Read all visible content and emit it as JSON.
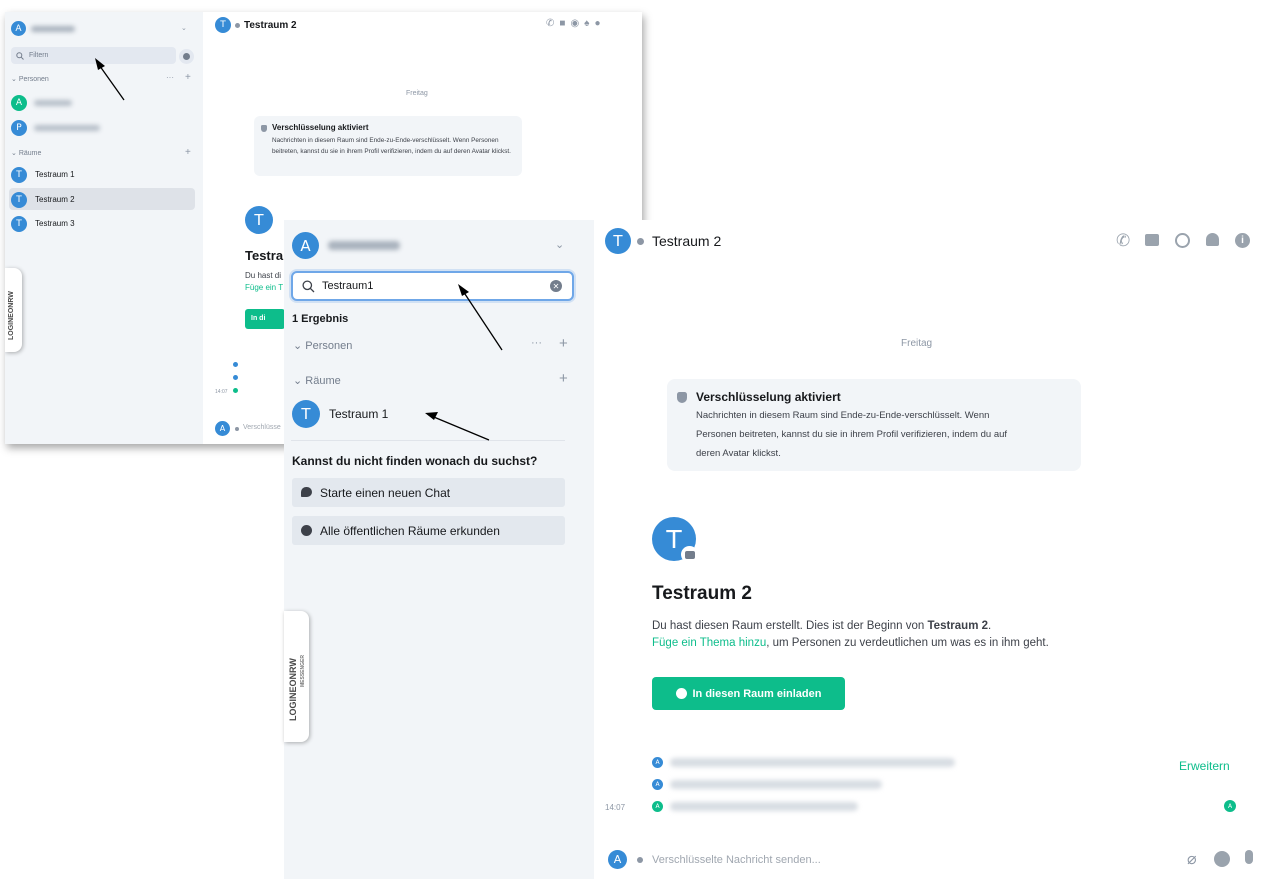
{
  "back_window": {
    "filter_placeholder": "Filtern",
    "section_people": "Personen",
    "section_rooms": "Räume",
    "rooms": [
      "Testraum 1",
      "Testraum 2",
      "Testraum 3"
    ],
    "room_avatar_letter": "T",
    "user_avatar_letter": "A",
    "person_avatars": [
      "A",
      "P"
    ],
    "header_title": "Testraum 2",
    "day_separator": "Freitag",
    "encryption_title": "Verschlüsselung aktiviert",
    "encryption_body": "Nachrichten in diesem Raum sind Ende-zu-Ende-verschlüsselt. Wenn Personen beitreten, kannst du sie in ihrem Profil verifizieren, indem du auf deren Avatar klickst.",
    "intro_title_partial": "Testra",
    "intro_line1_partial": "Du hast di",
    "intro_line2_partial": "Füge ein T",
    "invite_partial": "In di",
    "timestamp": "14:07",
    "composer_partial": "Verschlüsse"
  },
  "front_window": {
    "user_avatar_letter": "A",
    "search_value": "Testraum1",
    "result_count": "1 Ergebnis",
    "section_people": "Personen",
    "section_rooms": "Räume",
    "room_result": "Testraum 1",
    "room_avatar_letter": "T",
    "not_found_heading": "Kannst du nicht finden wonach du suchst?",
    "start_chat_label": "Starte einen neuen Chat",
    "explore_rooms_label": "Alle öffentlichen Räume erkunden",
    "header_title": "Testraum 2",
    "day_separator": "Freitag",
    "encryption_title": "Verschlüsselung aktiviert",
    "encryption_body_line1": "Nachrichten in diesem Raum sind Ende-zu-Ende-verschlüsselt. Wenn",
    "encryption_body_line2": "Personen beitreten, kannst du sie in ihrem Profil verifizieren, indem du auf",
    "encryption_body_line3": "deren Avatar klickst.",
    "intro_title": "Testraum 2",
    "intro_text_before": "Du hast diesen Raum erstellt. Dies ist der Beginn von",
    "intro_text_room": "Testraum 2",
    "intro_link": "Füge ein Thema hinzu",
    "intro_text_after": ", um Personen zu verdeutlichen um was es in ihm geht.",
    "invite_label": "In diesen Raum einladen",
    "expand_label": "Erweitern",
    "timestamp": "14:07",
    "composer_placeholder": "Verschlüsselte Nachricht senden..."
  },
  "branding": {
    "logo_text": "LOGINEONRW",
    "logo_sub": "MESSENGER"
  },
  "colors": {
    "accent_blue": "#368bd6",
    "accent_green": "#0dbd8b",
    "sidebar_bg": "#f2f5f8"
  }
}
